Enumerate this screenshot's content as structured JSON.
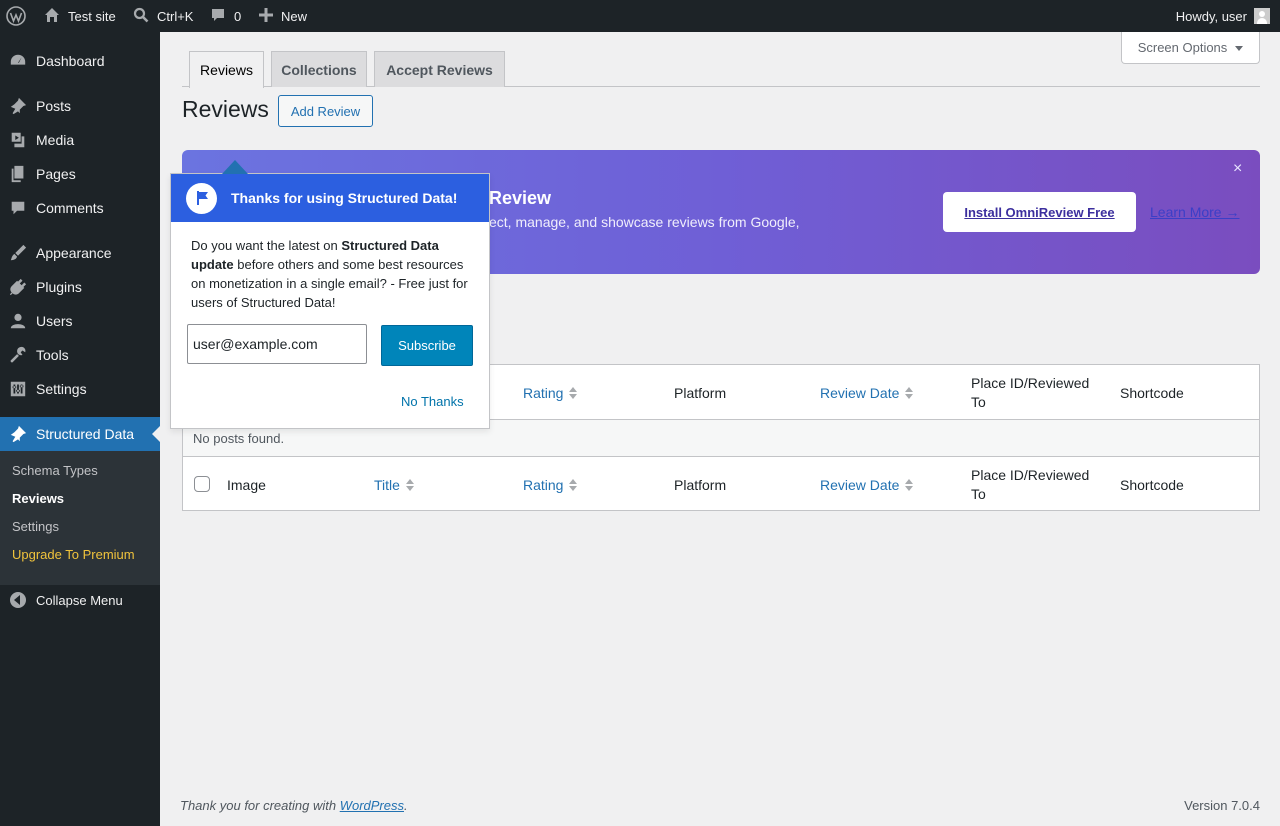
{
  "admin_bar": {
    "site_name": "Test site",
    "search_shortcut": "Ctrl+K",
    "comments_count": "0",
    "new_label": "New",
    "howdy": "Howdy, user"
  },
  "sidebar": {
    "items": [
      {
        "label": "Dashboard",
        "icon": "dashboard-icon"
      },
      {
        "label": "Posts",
        "icon": "pin-icon"
      },
      {
        "label": "Media",
        "icon": "media-icon"
      },
      {
        "label": "Pages",
        "icon": "pages-icon"
      },
      {
        "label": "Comments",
        "icon": "comment-icon"
      },
      {
        "label": "Appearance",
        "icon": "brush-icon"
      },
      {
        "label": "Plugins",
        "icon": "plug-icon"
      },
      {
        "label": "Users",
        "icon": "user-icon"
      },
      {
        "label": "Tools",
        "icon": "wrench-icon"
      },
      {
        "label": "Settings",
        "icon": "sliders-icon"
      },
      {
        "label": "Structured Data",
        "icon": "pin-icon"
      }
    ],
    "submenu": [
      "Schema Types",
      "Reviews",
      "Settings",
      "Upgrade To Premium"
    ],
    "collapse_label": "Collapse Menu"
  },
  "screen_options": "Screen Options",
  "tabs": [
    "Reviews",
    "Collections",
    "Accept Reviews"
  ],
  "page_title": "Reviews",
  "add_review_label": "Add Review",
  "banner": {
    "title": "Review",
    "description": "ect, manage, and showcase reviews from Google,",
    "install_label": "Install OmniReview Free",
    "learn_more_label": "Learn More →",
    "close": "×"
  },
  "table": {
    "columns": {
      "image": "Image",
      "title": "Title",
      "rating": "Rating",
      "platform": "Platform",
      "review_date": "Review Date",
      "place_id_line1": "Place ID/Reviewed",
      "place_id_line2": "To",
      "shortcode": "Shortcode"
    },
    "empty_message": "No posts found."
  },
  "popup": {
    "title": "Thanks for using Structured Data!",
    "body_1": "Do you want the latest on ",
    "body_bold_1": "Structured Data update",
    "body_2": " before others and some best resources on monetization in a single email? - Free just for users of Structured Data!",
    "email_value": "user@example.com",
    "subscribe_label": "Subscribe",
    "no_thanks_label": "No Thanks"
  },
  "footer": {
    "thanks_prefix": "Thank you for creating with ",
    "wordpress_link": "WordPress",
    "thanks_suffix": ".",
    "version": "Version 7.0.4"
  }
}
